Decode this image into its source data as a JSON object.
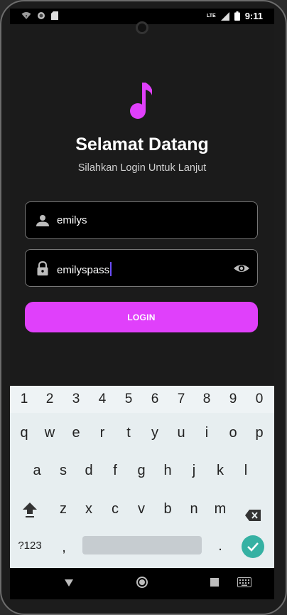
{
  "status_bar": {
    "time": "9:11",
    "network": "LTE"
  },
  "app": {
    "title": "Selamat Datang",
    "subtitle": "Silahkan Login Untuk Lanjut",
    "username": {
      "value": "emilys",
      "icon": "person-icon"
    },
    "password": {
      "value": "emilyspass",
      "icon": "lock-icon",
      "toggle_icon": "eye-icon"
    },
    "login_label": "LOGIN",
    "logo_icon": "music-note-icon",
    "accent_color": "#e040fb"
  },
  "keyboard": {
    "numbers": [
      "1",
      "2",
      "3",
      "4",
      "5",
      "6",
      "7",
      "8",
      "9",
      "0"
    ],
    "row1": [
      "q",
      "w",
      "e",
      "r",
      "t",
      "y",
      "u",
      "i",
      "o",
      "p"
    ],
    "row2": [
      "a",
      "s",
      "d",
      "f",
      "g",
      "h",
      "j",
      "k",
      "l"
    ],
    "row3": [
      "z",
      "x",
      "c",
      "v",
      "b",
      "n",
      "m"
    ],
    "symbols_label": "?123",
    "comma": ",",
    "period": ".",
    "enter_color": "#35b1a3"
  },
  "nav": {
    "back_icon": "back-triangle-icon",
    "home_icon": "home-circle-icon",
    "recents_icon": "recents-square-icon",
    "keyboard_icon": "keyboard-icon"
  }
}
